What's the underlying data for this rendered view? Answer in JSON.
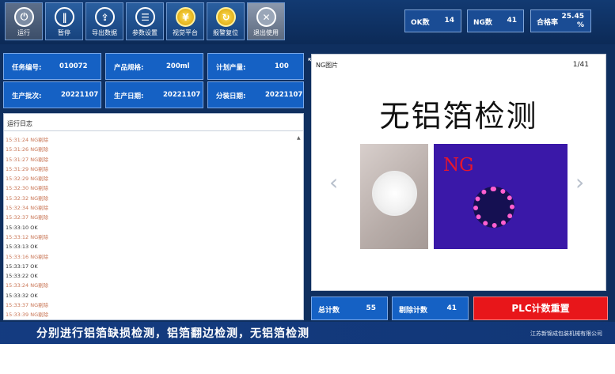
{
  "toolbar": {
    "buttons": [
      {
        "label": "运行",
        "glyph": "⏻",
        "icon": "power-icon"
      },
      {
        "label": "暂停",
        "glyph": "‖",
        "icon": "pause-icon"
      },
      {
        "label": "导出数据",
        "glyph": "⇪",
        "icon": "export-icon"
      },
      {
        "label": "参数设置",
        "glyph": "☰",
        "icon": "sliders-icon"
      },
      {
        "label": "视觉平台",
        "glyph": "¥",
        "icon": "vision-coin-icon"
      },
      {
        "label": "报警复位",
        "glyph": "↻",
        "icon": "alarm-reset-icon"
      },
      {
        "label": "退出使用",
        "glyph": "✕",
        "icon": "close-icon"
      }
    ]
  },
  "stats": {
    "ok_label": "OK数",
    "ok_value": "14",
    "ng_label": "NG数",
    "ng_value": "41",
    "rate_label": "合格率",
    "rate_value_1": "25.45",
    "rate_value_2": "%"
  },
  "info": {
    "task_no_label": "任务编号:",
    "task_no": "010072",
    "spec_label": "产品规格:",
    "spec": "200ml",
    "plan_label": "计划产量:",
    "plan": "100",
    "batch_label": "生产批次:",
    "batch": "20221107",
    "prod_date_label": "生产日期:",
    "prod_date": "20221107",
    "pack_date_label": "分装日期:",
    "pack_date": "20221107"
  },
  "log": {
    "title": "运行日志",
    "lines": [
      {
        "text": "15:31:24 NG剔除",
        "ng": true
      },
      {
        "text": "15:31:26 NG剔除",
        "ng": true
      },
      {
        "text": "15:31:27 NG剔除",
        "ng": true
      },
      {
        "text": "15:31:29 NG剔除",
        "ng": true
      },
      {
        "text": "15:32:29 NG剔除",
        "ng": true
      },
      {
        "text": "15:32:30 NG剔除",
        "ng": true
      },
      {
        "text": "15:32:32 NG剔除",
        "ng": true
      },
      {
        "text": "15:32:34 NG剔除",
        "ng": true
      },
      {
        "text": "15:32:37 NG剔除",
        "ng": true
      },
      {
        "text": "15:33:10 OK",
        "ng": false
      },
      {
        "text": "15:33:12 NG剔除",
        "ng": true
      },
      {
        "text": "15:33:13 OK",
        "ng": false
      },
      {
        "text": "15:33:16 NG剔除",
        "ng": true
      },
      {
        "text": "15:33:17 OK",
        "ng": false
      },
      {
        "text": "15:33:22 OK",
        "ng": false
      },
      {
        "text": "15:33:24 NG剔除",
        "ng": true
      },
      {
        "text": "15:33:32 OK",
        "ng": false
      },
      {
        "text": "15:33:37 NG剔除",
        "ng": true
      },
      {
        "text": "15:33:39 NG剔除",
        "ng": true
      }
    ]
  },
  "ng_panel": {
    "title": "NG图片",
    "page": "1/41",
    "caption": "无铝箔检测",
    "overlay": "NG"
  },
  "counters": {
    "total_label": "总计数",
    "total": "55",
    "reject_label": "剔除计数",
    "reject": "41",
    "plc_reset": "PLC计数重置"
  },
  "banner": {
    "text": "分别进行铝箔缺损检测，铝箔翻边检测，无铝箔检测",
    "company": "江苏新锦成包装机械有限公司"
  },
  "colors": {
    "accent": "#1561c4",
    "danger": "#e8161a",
    "panel": "#0f2f5f"
  }
}
